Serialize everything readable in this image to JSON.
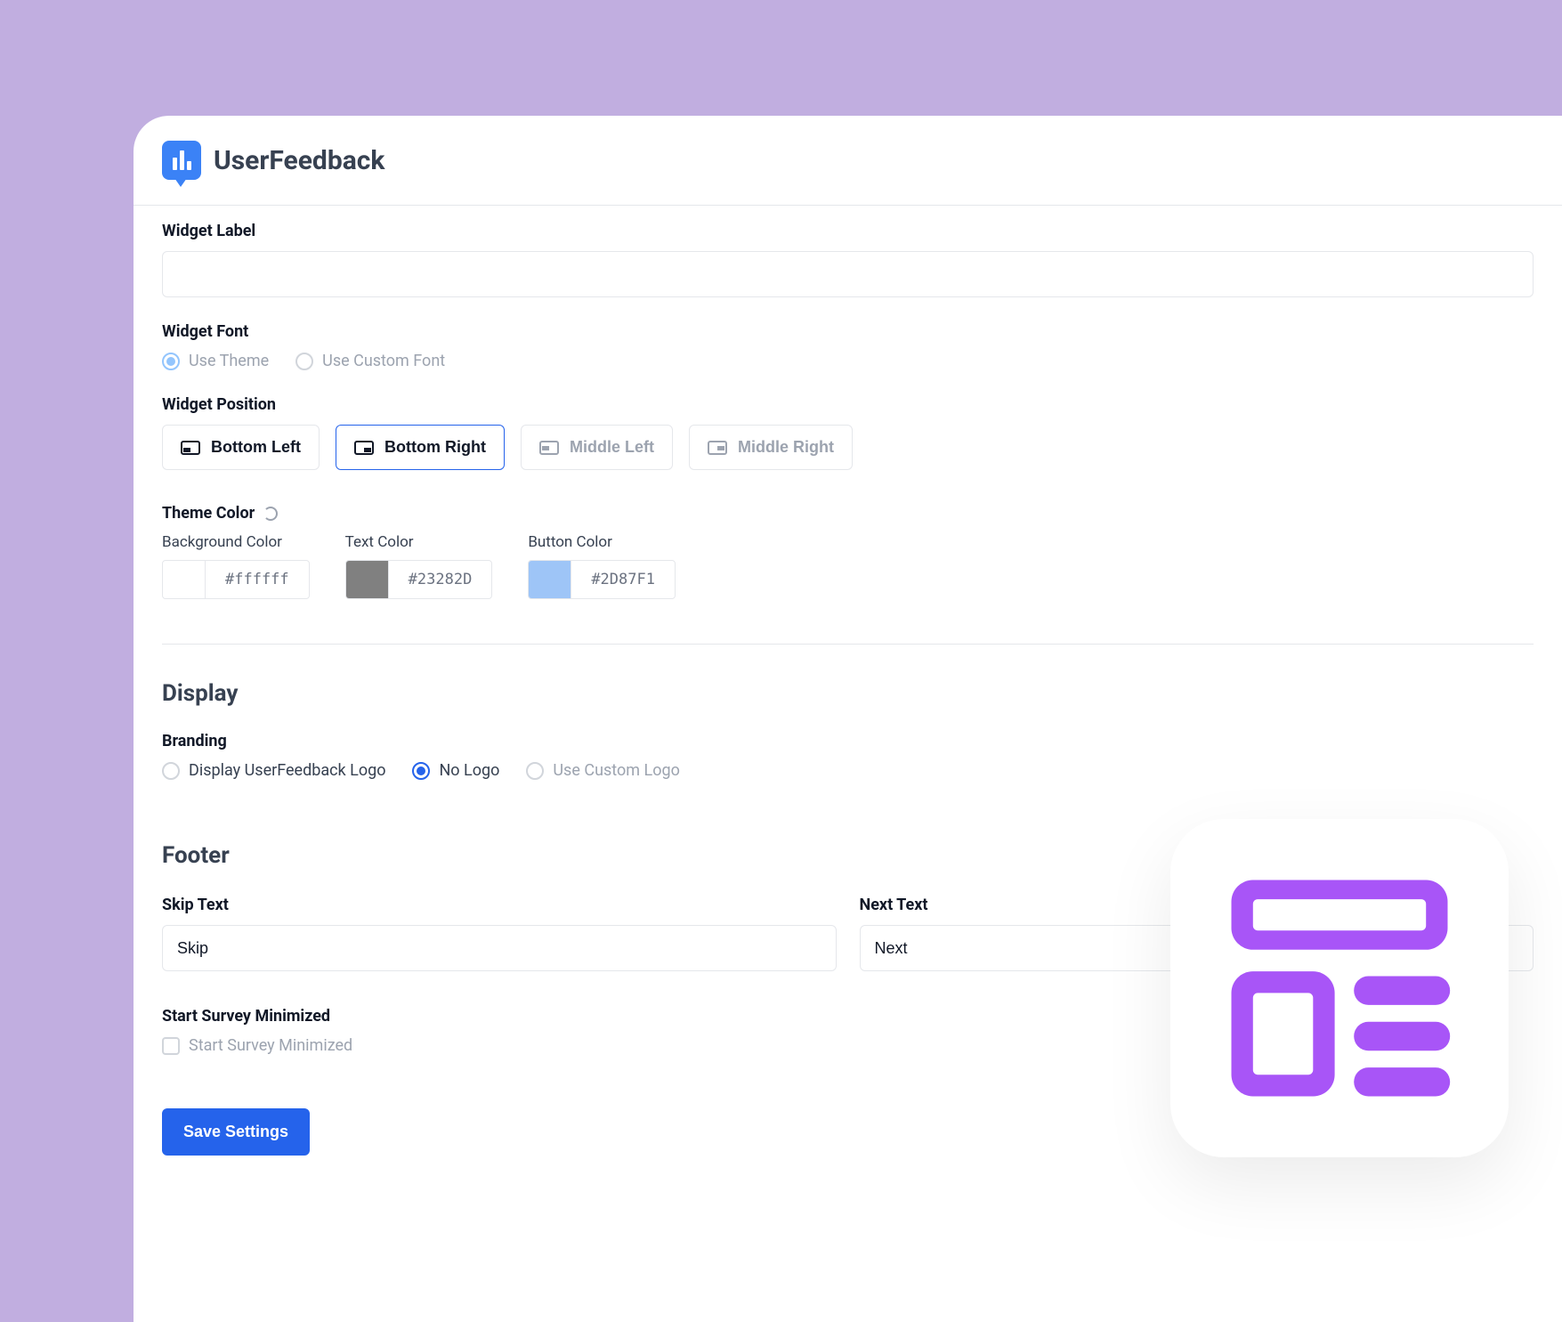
{
  "brand": "UserFeedback",
  "widget_label": {
    "title": "Widget Label",
    "value": ""
  },
  "widget_font": {
    "title": "Widget Font",
    "options": [
      "Use Theme",
      "Use Custom Font"
    ],
    "selected": "Use Theme"
  },
  "widget_position": {
    "title": "Widget Position",
    "options": [
      "Bottom Left",
      "Bottom Right",
      "Middle Left",
      "Middle Right"
    ],
    "selected": "Bottom Right"
  },
  "theme_color": {
    "title": "Theme Color",
    "background": {
      "label": "Background Color",
      "value": "#ffffff"
    },
    "text": {
      "label": "Text Color",
      "value": "#23282D"
    },
    "button": {
      "label": "Button Color",
      "value": "#2D87F1"
    }
  },
  "display": {
    "title": "Display",
    "branding": {
      "title": "Branding",
      "options": [
        "Display UserFeedback Logo",
        "No Logo",
        "Use Custom Logo"
      ],
      "selected": "No Logo"
    }
  },
  "footer": {
    "title": "Footer",
    "skip": {
      "label": "Skip Text",
      "value": "Skip"
    },
    "next": {
      "label": "Next Text",
      "value": "Next"
    },
    "start_minimized": {
      "title": "Start Survey Minimized",
      "checkbox_label": "Start Survey Minimized",
      "checked": false
    }
  },
  "save_label": "Save Settings",
  "colors": {
    "swatch_bg": "#ffffff",
    "swatch_text": "#808080",
    "swatch_button": "#9ec5f7"
  }
}
